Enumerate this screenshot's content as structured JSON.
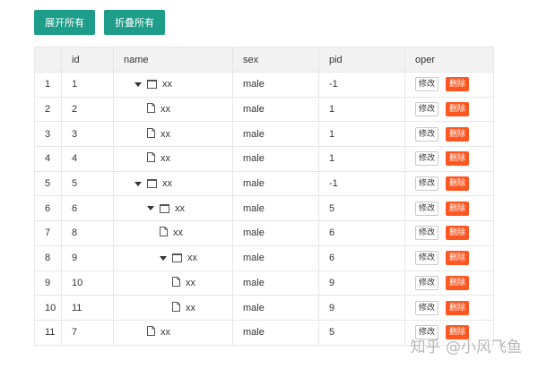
{
  "toolbar": {
    "expand_label": "展开所有",
    "collapse_label": "折叠所有"
  },
  "table": {
    "columns": [
      "",
      "id",
      "name",
      "sex",
      "pid",
      "oper"
    ],
    "rows": [
      {
        "index": "1",
        "id": "1",
        "name": "xx",
        "sex": "male",
        "pid": "-1",
        "depth": 0,
        "type": "folder"
      },
      {
        "index": "2",
        "id": "2",
        "name": "xx",
        "sex": "male",
        "pid": "1",
        "depth": 1,
        "type": "file"
      },
      {
        "index": "3",
        "id": "3",
        "name": "xx",
        "sex": "male",
        "pid": "1",
        "depth": 1,
        "type": "file"
      },
      {
        "index": "4",
        "id": "4",
        "name": "xx",
        "sex": "male",
        "pid": "1",
        "depth": 1,
        "type": "file"
      },
      {
        "index": "5",
        "id": "5",
        "name": "xx",
        "sex": "male",
        "pid": "-1",
        "depth": 0,
        "type": "folder"
      },
      {
        "index": "6",
        "id": "6",
        "name": "xx",
        "sex": "male",
        "pid": "5",
        "depth": 1,
        "type": "folder"
      },
      {
        "index": "7",
        "id": "8",
        "name": "xx",
        "sex": "male",
        "pid": "6",
        "depth": 2,
        "type": "file"
      },
      {
        "index": "8",
        "id": "9",
        "name": "xx",
        "sex": "male",
        "pid": "6",
        "depth": 2,
        "type": "folder"
      },
      {
        "index": "9",
        "id": "10",
        "name": "xx",
        "sex": "male",
        "pid": "9",
        "depth": 3,
        "type": "file"
      },
      {
        "index": "10",
        "id": "11",
        "name": "xx",
        "sex": "male",
        "pid": "9",
        "depth": 3,
        "type": "file"
      },
      {
        "index": "11",
        "id": "7",
        "name": "xx",
        "sex": "male",
        "pid": "5",
        "depth": 1,
        "type": "file"
      }
    ],
    "edit_label": "修改",
    "delete_label": "删除"
  },
  "colors": {
    "primary": "#1e9e8a",
    "danger": "#ff5722",
    "header_bg": "#f2f2f2",
    "border": "#e6e6e6"
  },
  "icons": {
    "expanded": "caret-down-icon",
    "folder": "folder-icon",
    "file": "file-icon"
  },
  "watermark": "知乎 @小风飞鱼"
}
